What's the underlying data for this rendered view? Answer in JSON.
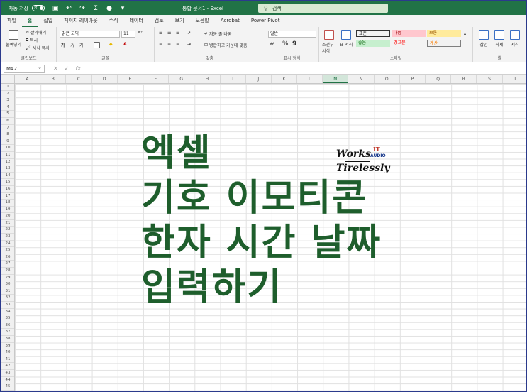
{
  "titlebar": {
    "autosave_label": "자동 저장",
    "autosave_state": "끔",
    "doc_title": "통합 문서1 - Excel",
    "search_placeholder": "검색"
  },
  "tabs": [
    "파일",
    "홈",
    "삽입",
    "페이지 레이아웃",
    "수식",
    "데이터",
    "검토",
    "보기",
    "도움말",
    "Acrobat",
    "Power Pivot"
  ],
  "active_tab": "홈",
  "ribbon": {
    "clipboard": {
      "label": "클립보드",
      "paste": "붙여넣기",
      "cut": "잘라내기",
      "copy": "복사",
      "format_painter": "서식 복사"
    },
    "font": {
      "label": "글꼴",
      "font_name": "맑은 고딕",
      "font_size": "11",
      "bold": "가",
      "italic": "가",
      "underline": "가"
    },
    "alignment": {
      "label": "맞춤",
      "wrap": "자동 줄 바꿈",
      "merge": "병합하고 가운데 맞춤"
    },
    "number": {
      "label": "표시 형식",
      "format": "일반",
      "percent": "%",
      "comma": "9"
    },
    "styles": {
      "label": "스타일",
      "conditional": "조건부 서식",
      "table": "표 서식",
      "cells": [
        {
          "name": "표준",
          "bg": "#ffffff",
          "fg": "#000000"
        },
        {
          "name": "나쁨",
          "bg": "#ffc7ce",
          "fg": "#9c0006"
        },
        {
          "name": "보통",
          "bg": "#ffeb9c",
          "fg": "#9c5700"
        },
        {
          "name": "좋음",
          "bg": "#c6efce",
          "fg": "#006100"
        },
        {
          "name": "경고문",
          "bg": "#ffffff",
          "fg": "#ff0000"
        },
        {
          "name": "계산",
          "bg": "#f2f2f2",
          "fg": "#fa7d00"
        }
      ]
    },
    "cells": {
      "label": "셀",
      "insert": "삽입",
      "delete": "삭제",
      "format": "서식"
    }
  },
  "formula_bar": {
    "name_box": "M42",
    "fx": "fx"
  },
  "grid": {
    "columns": [
      "A",
      "B",
      "C",
      "D",
      "E",
      "F",
      "G",
      "H",
      "I",
      "J",
      "K",
      "L",
      "M",
      "N",
      "O",
      "P",
      "Q",
      "R",
      "S",
      "T"
    ],
    "selected_column": "M",
    "rows": [
      "1",
      "2",
      "3",
      "4",
      "5",
      "6",
      "7",
      "8",
      "9",
      "10",
      "11",
      "12",
      "13",
      "14",
      "15",
      "16",
      "17",
      "18",
      "19",
      "20",
      "21",
      "22",
      "23",
      "24",
      "25",
      "26",
      "27",
      "28",
      "29",
      "30",
      "31",
      "32",
      "33",
      "34",
      "35",
      "36",
      "37",
      "38",
      "39",
      "40",
      "41",
      "42",
      "43",
      "44",
      "45"
    ]
  },
  "headline": {
    "line1": "엑셀",
    "line2": "기호 이모티콘",
    "line3": "한자 시간 날짜",
    "line4": "입력하기",
    "color": "#1e5e2c"
  },
  "logo": {
    "works": "Works",
    "tirelessly": "Tirelessly",
    "it": "IT",
    "audio": "AUDIO"
  },
  "colors": {
    "excel_green": "#217346",
    "frame": "#2b3a8c"
  }
}
